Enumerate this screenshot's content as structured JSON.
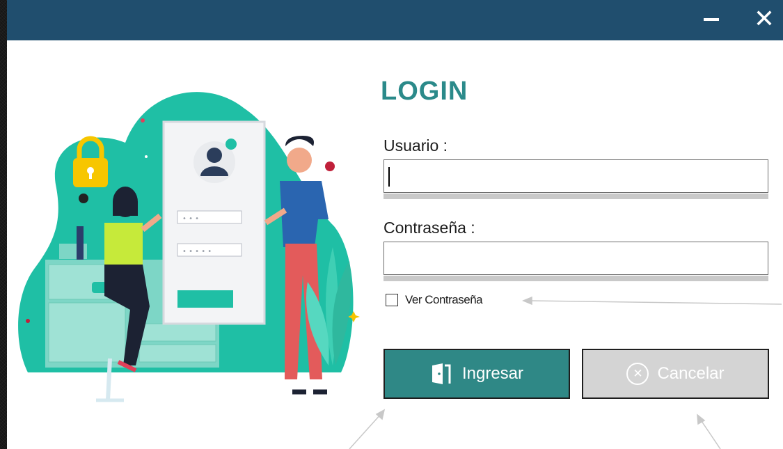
{
  "window": {
    "minimize_icon": "minimize-icon",
    "close_icon": "close-icon",
    "titlebar_color": "#204e6e"
  },
  "login": {
    "title": "LOGIN",
    "username_label": "Usuario :",
    "username_value": "",
    "password_label": "Contraseña :",
    "password_value": "",
    "show_password_label": "Ver Contraseña",
    "show_password_checked": false,
    "submit_label": "Ingresar",
    "submit_icon": "door-icon",
    "submit_color": "#2f8886",
    "cancel_label": "Cancelar",
    "cancel_icon": "circle-x-icon",
    "cancel_color": "#d4d4d4",
    "accent_color": "#2b8a8a"
  },
  "illustration": {
    "icon": "login-illustration",
    "form_mock_placeholders": [
      "• • •",
      "• • • • •"
    ]
  }
}
